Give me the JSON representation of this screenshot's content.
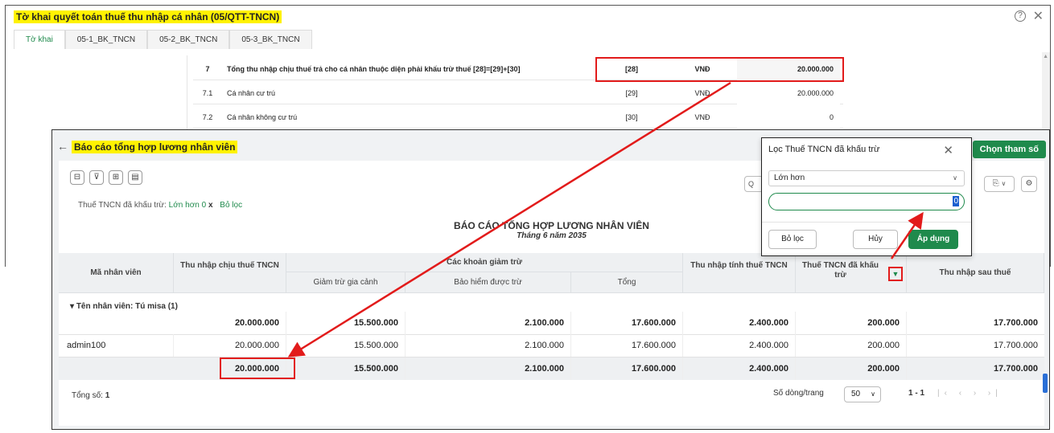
{
  "back_window": {
    "title": "Tờ khai quyết toán thuế thu nhập cá nhân (05/QTT-TNCN)",
    "help_icon": "question-circle-icon",
    "close_icon": "close-icon",
    "tabs": [
      {
        "label": "Tờ khai",
        "active": true
      },
      {
        "label": "05-1_BK_TNCN",
        "active": false
      },
      {
        "label": "05-2_BK_TNCN",
        "active": false
      },
      {
        "label": "05-3_BK_TNCN",
        "active": false
      }
    ],
    "rows": [
      {
        "no": "7",
        "name": "Tổng thu nhập chịu thuế trả cho cá nhân thuộc diện phải khấu trừ thuế [28]=[29]+[30]",
        "code": "[28]",
        "unit": "VNĐ",
        "value": "20.000.000",
        "bold": true
      },
      {
        "no": "7.1",
        "name": "Cá nhân cư trú",
        "code": "[29]",
        "unit": "VNĐ",
        "value": "20.000.000",
        "bold": false
      },
      {
        "no": "7.2",
        "name": "Cá nhân không cư trú",
        "code": "[30]",
        "unit": "VNĐ",
        "value": "0",
        "bold": false
      }
    ]
  },
  "report_window": {
    "title": "Báo cáo tổng hợp lương nhân viên",
    "choose_params_label": "Chọn tham số",
    "filter_text": "Thuế TNCN đã khấu trừ:",
    "filter_value": "Lớn hơn 0",
    "filter_remove": "x",
    "clear_filter_link": "Bỏ lọc",
    "report_title": "BÁO CÁO TỔNG HỢP LƯƠNG NHÂN VIÊN",
    "report_subtitle": "Tháng 6 năm 2035",
    "search_prefix": "Q",
    "headers": {
      "employee_code": "Mã nhân viên",
      "taxable_income": "Thu nhập chịu thuế TNCN",
      "deductions_group": "Các khoản giảm trừ",
      "family_deduction": "Giảm trừ gia cảnh",
      "insurance_deduction": "Bảo hiểm được trừ",
      "total": "Tổng",
      "assessable_income": "Thu nhập tính thuế TNCN",
      "tax_withheld": "Thuế TNCN đã khấu trừ",
      "after_tax": "Thu nhập sau thuế"
    },
    "group_label": "Tên nhân viên: Tú misa (1)",
    "group_totals": [
      "20.000.000",
      "15.500.000",
      "2.100.000",
      "17.600.000",
      "2.400.000",
      "200.000",
      "17.700.000"
    ],
    "rows": [
      {
        "code": "admin100",
        "values": [
          "20.000.000",
          "15.500.000",
          "2.100.000",
          "17.600.000",
          "2.400.000",
          "200.000",
          "17.700.000"
        ]
      }
    ],
    "grand_totals": [
      "20.000.000",
      "15.500.000",
      "2.100.000",
      "17.600.000",
      "2.400.000",
      "200.000",
      "17.700.000"
    ],
    "total_count_label": "Tổng số:",
    "total_count": "1",
    "rows_per_page_label": "Số dòng/trang",
    "rows_per_page": "50",
    "page_range": "1 - 1"
  },
  "filter_popup": {
    "title": "Lọc Thuế TNCN đã khấu trừ",
    "operator": "Lớn hơn",
    "value": "0",
    "clear_label": "Bỏ lọc",
    "cancel_label": "Hủy",
    "apply_label": "Áp dụng"
  },
  "colors": {
    "accent_green": "#1f8a4c",
    "highlight_yellow": "#fff200",
    "annotation_red": "#e21b1b"
  }
}
